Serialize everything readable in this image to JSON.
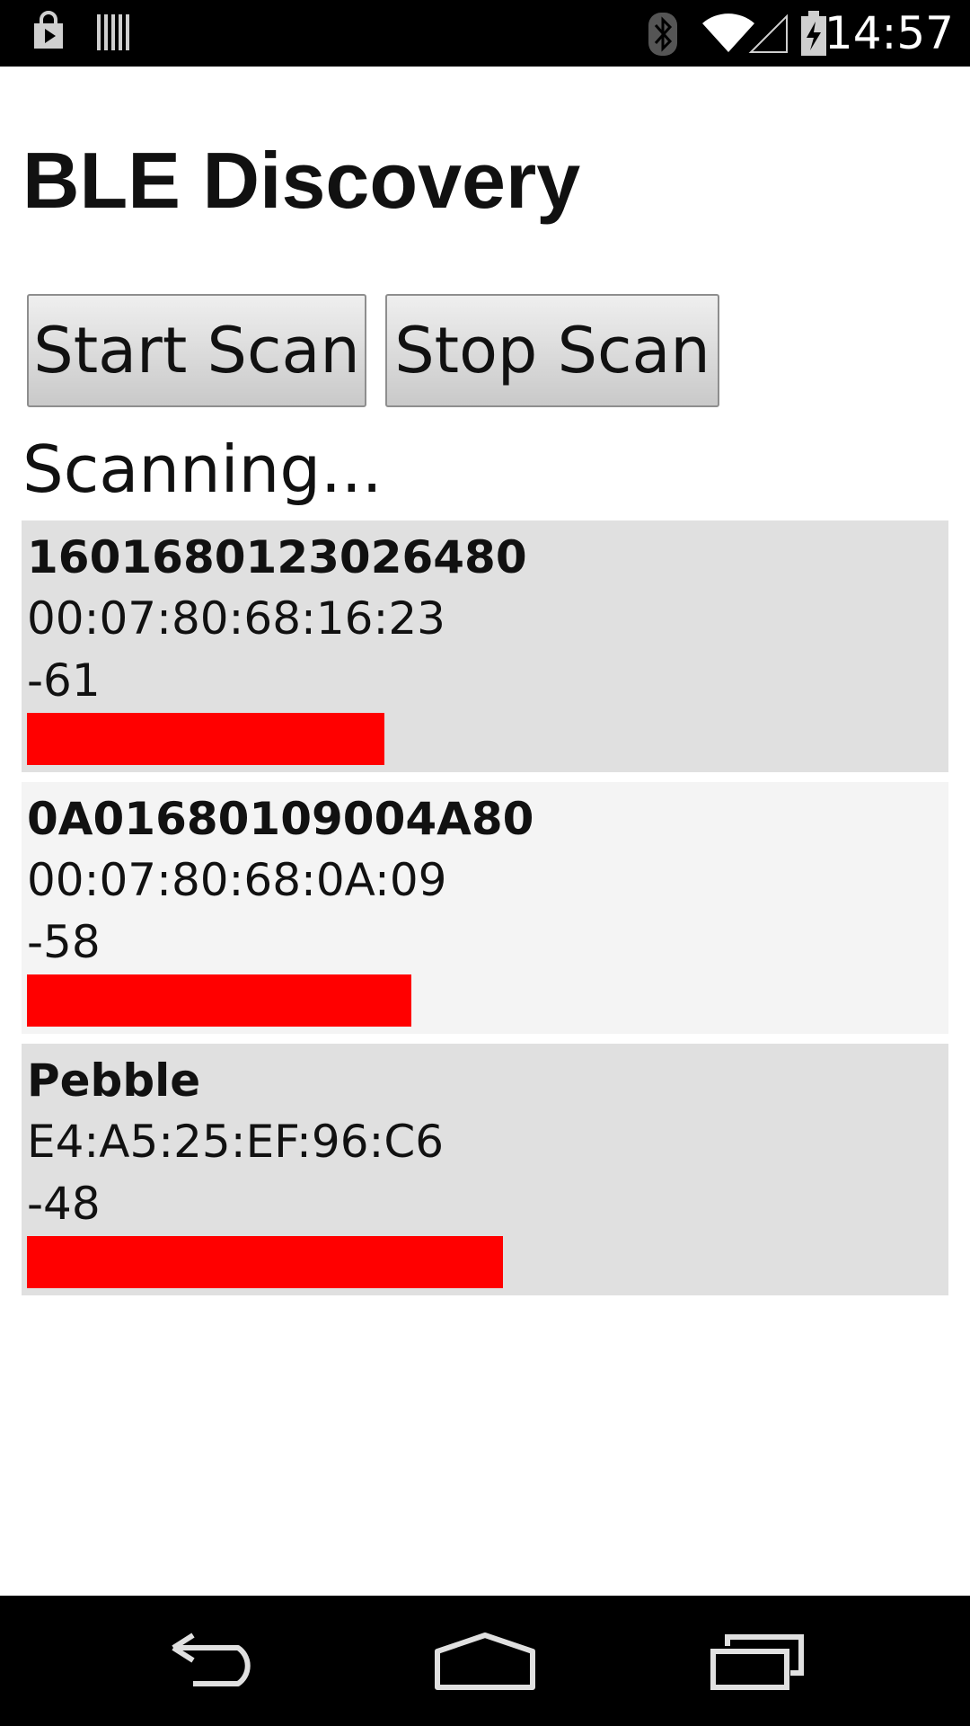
{
  "status_bar": {
    "time": "14:57",
    "icons": [
      "play-store-icon",
      "barcode-icon",
      "bluetooth-icon",
      "wifi-icon",
      "signal-icon",
      "battery-charging-icon"
    ]
  },
  "app": {
    "title": "BLE Discovery",
    "start_button_label": "Start Scan",
    "stop_button_label": "Stop Scan",
    "status": "Scanning..."
  },
  "devices": [
    {
      "name": "1601680123026480",
      "address": "00:07:80:68:16:23",
      "rssi": "-61",
      "signal_fraction": 0.39
    },
    {
      "name": "0A01680109004A80",
      "address": "00:07:80:68:0A:09",
      "rssi": "-58",
      "signal_fraction": 0.42
    },
    {
      "name": "Pebble",
      "address": "E4:A5:25:EF:96:C6",
      "rssi": "-48",
      "signal_fraction": 0.52
    }
  ],
  "colors": {
    "signal_bar": "#ff0000",
    "row_dark": "#e0e0e0",
    "row_light": "#f4f4f4"
  },
  "nav_bar": {
    "icons": [
      "back-icon",
      "home-icon",
      "recents-icon"
    ]
  }
}
